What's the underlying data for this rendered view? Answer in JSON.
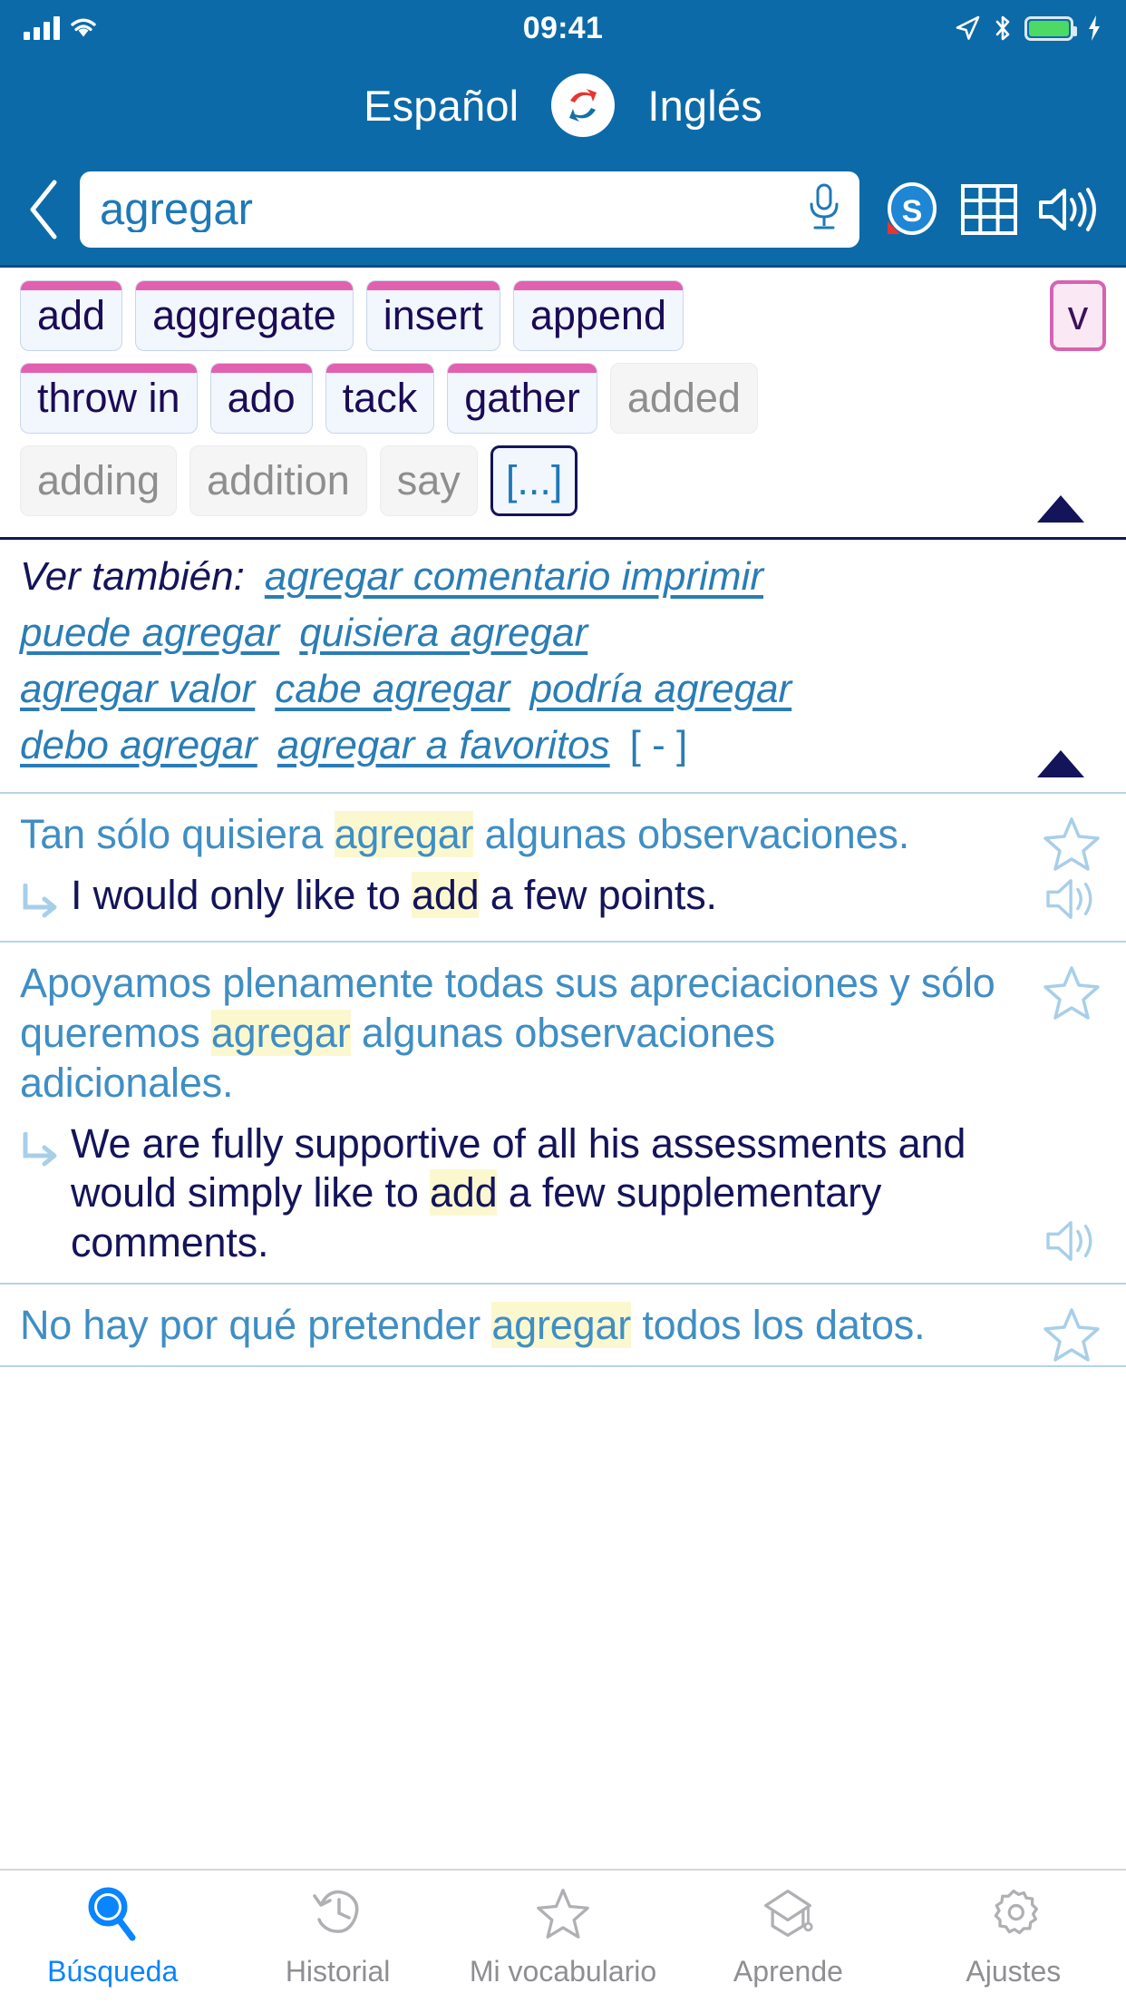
{
  "status_bar": {
    "time": "09:41"
  },
  "header": {
    "source_language": "Español",
    "target_language": "Inglés",
    "swap_icon": "swap-languages-icon",
    "accent_color": "#0d6aa8"
  },
  "search": {
    "value": "agregar",
    "placeholder": "agregar",
    "back_icon": "back-chevron-icon",
    "mic_icon": "microphone-icon",
    "actions": [
      {
        "name": "skype-translate-icon",
        "label": "S"
      },
      {
        "name": "conjugation-table-icon",
        "label": ""
      },
      {
        "name": "speaker-icon",
        "label": ""
      }
    ]
  },
  "translations": {
    "rows": [
      [
        {
          "label": "add",
          "state": "primary"
        },
        {
          "label": "aggregate",
          "state": "primary"
        },
        {
          "label": "insert",
          "state": "primary"
        },
        {
          "label": "append",
          "state": "primary"
        }
      ],
      [
        {
          "label": "throw in",
          "state": "primary"
        },
        {
          "label": "ado",
          "state": "primary"
        },
        {
          "label": "tack",
          "state": "primary"
        },
        {
          "label": "gather",
          "state": "primary"
        },
        {
          "label": "added",
          "state": "muted"
        }
      ],
      [
        {
          "label": "adding",
          "state": "muted"
        },
        {
          "label": "addition",
          "state": "muted"
        },
        {
          "label": "say",
          "state": "muted"
        },
        {
          "label": "[...]",
          "state": "more"
        }
      ]
    ],
    "pos_badge": "v",
    "collapse_icon": "collapse-triangle-icon"
  },
  "see_also": {
    "label": "Ver también:",
    "lines": [
      [
        "agregar comentario imprimir"
      ],
      [
        "puede agregar",
        "quisiera agregar"
      ],
      [
        "agregar valor",
        "cabe agregar",
        "podría agregar"
      ],
      [
        "debo agregar",
        "agregar a favoritos"
      ]
    ],
    "minus": "[ - ]",
    "collapse_icon": "collapse-triangle-icon"
  },
  "examples": [
    {
      "source_pre": "Tan sólo quisiera ",
      "source_hl": "agregar",
      "source_post": " algunas observaciones.",
      "target_pre": "I would only like to ",
      "target_hl": "add",
      "target_post": " a few points.",
      "star_icon": "star-outline-icon",
      "speaker_icon": "speaker-icon"
    },
    {
      "source_pre": "Apoyamos plenamente todas sus apreciaciones y sólo queremos ",
      "source_hl": "agregar",
      "source_post": " algunas observaciones adicionales.",
      "target_pre": "We are fully supportive of all his assessments and would simply like to ",
      "target_hl": "add",
      "target_post": " a few supplementary comments.",
      "star_icon": "star-outline-icon",
      "speaker_icon": "speaker-icon"
    },
    {
      "source_pre": "No hay por qué pretender ",
      "source_hl": "agregar",
      "source_post": " todos los datos.",
      "target_pre": "",
      "target_hl": "",
      "target_post": "",
      "star_icon": "star-outline-icon",
      "speaker_icon": "speaker-icon"
    }
  ],
  "tabbar": {
    "active_color": "#0a84ff",
    "inactive_color": "#8e8e93",
    "items": [
      {
        "label": "Búsqueda",
        "icon": "search-icon",
        "active": true
      },
      {
        "label": "Historial",
        "icon": "history-icon",
        "active": false
      },
      {
        "label": "Mi vocabulario",
        "icon": "star-icon",
        "active": false
      },
      {
        "label": "Aprende",
        "icon": "graduation-icon",
        "active": false
      },
      {
        "label": "Ajustes",
        "icon": "gear-icon",
        "active": false
      }
    ]
  }
}
